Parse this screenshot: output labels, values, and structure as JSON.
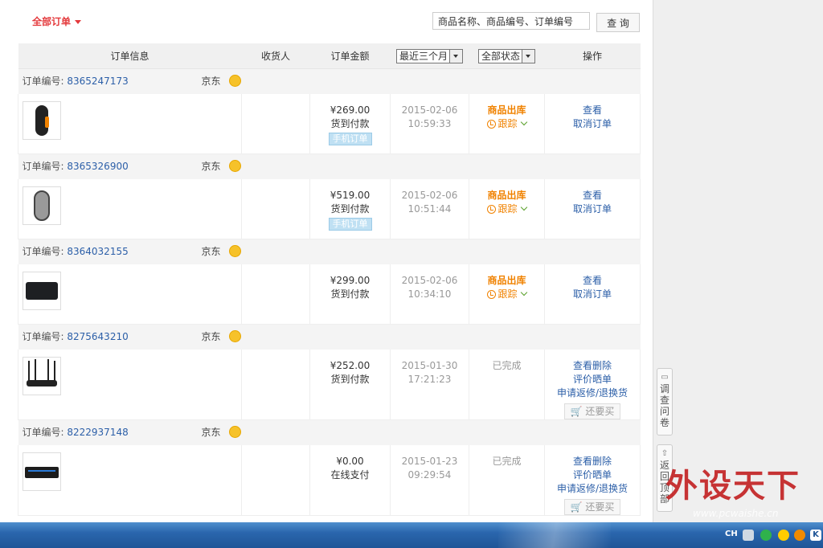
{
  "filter": {
    "label": "全部订单"
  },
  "search": {
    "value": "商品名称、商品编号、订单编号",
    "button": "查 询"
  },
  "table": {
    "headers": {
      "info": "订单信息",
      "receiver": "收货人",
      "amount": "订单金额",
      "time_select": "最近三个月",
      "status_select": "全部状态",
      "ops": "操作"
    }
  },
  "orders": [
    {
      "label": "订单编号:",
      "number": "8365247173",
      "shop": "京东",
      "product_icon": "mouse-orange-icon",
      "price": "¥269.00",
      "payment": "货到付款",
      "badge": "手机订单",
      "date": "2015-02-06",
      "time": "10:59:33",
      "status": "商品出库",
      "track": "跟踪",
      "ops": [
        "查看",
        "取消订单"
      ],
      "rebuy": ""
    },
    {
      "label": "订单编号:",
      "number": "8365326900",
      "shop": "京东",
      "product_icon": "mouse-grey-icon",
      "price": "¥519.00",
      "payment": "货到付款",
      "badge": "手机订单",
      "date": "2015-02-06",
      "time": "10:51:44",
      "status": "商品出库",
      "track": "跟踪",
      "ops": [
        "查看",
        "取消订单"
      ],
      "rebuy": ""
    },
    {
      "label": "订单编号:",
      "number": "8364032155",
      "shop": "京东",
      "product_icon": "mousepad-icon",
      "price": "¥299.00",
      "payment": "货到付款",
      "badge": "",
      "date": "2015-02-06",
      "time": "10:34:10",
      "status": "商品出库",
      "track": "跟踪",
      "ops": [
        "查看",
        "取消订单"
      ],
      "rebuy": ""
    },
    {
      "label": "订单编号:",
      "number": "8275643210",
      "shop": "京东",
      "product_icon": "router-icon",
      "price": "¥252.00",
      "payment": "货到付款",
      "badge": "",
      "date": "2015-01-30",
      "time": "17:21:23",
      "status": "已完成",
      "track": "",
      "ops": [
        "查看删除",
        "评价晒单",
        "申请返修/退换货"
      ],
      "rebuy": "还要买"
    },
    {
      "label": "订单编号:",
      "number": "8222937148",
      "shop": "京东",
      "product_icon": "keyboard-icon",
      "price": "¥0.00",
      "payment": "在线支付",
      "badge": "",
      "date": "2015-01-23",
      "time": "09:29:54",
      "status": "已完成",
      "track": "",
      "ops": [
        "查看删除",
        "评价晒单",
        "申请返修/退换货"
      ],
      "rebuy": "还要买"
    }
  ],
  "side": {
    "survey": "调查问卷",
    "back_top": "返回顶部"
  },
  "taskbar": {
    "lang": "CH"
  },
  "watermark": {
    "text": "外设天下",
    "url": "www.pcwaishe.cn"
  }
}
